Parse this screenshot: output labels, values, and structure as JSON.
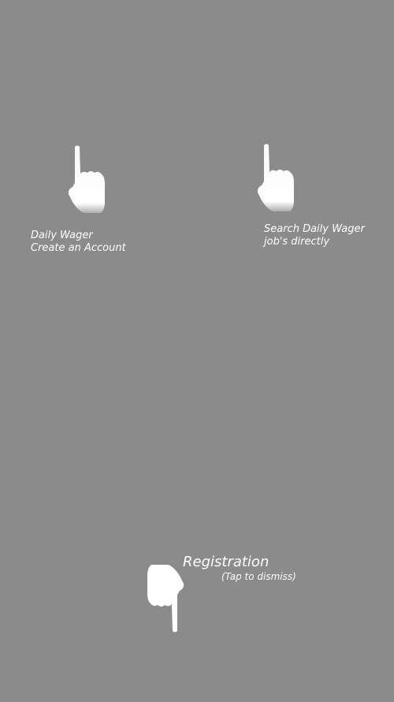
{
  "overlay": {
    "background_color": "#8a8b8a",
    "text_color": "#ffffff"
  },
  "hints": {
    "create_account": {
      "line1": "Daily Wager",
      "line2": "Create an Account",
      "icon": "pointing-hand-up-icon"
    },
    "search_jobs": {
      "line1": "Search Daily Wager",
      "line2": "job's directly",
      "icon": "pointing-hand-up-icon"
    },
    "registration": {
      "title": "Registration",
      "subtitle": "(Tap to dismiss)",
      "icon": "pointing-hand-down-icon"
    }
  }
}
